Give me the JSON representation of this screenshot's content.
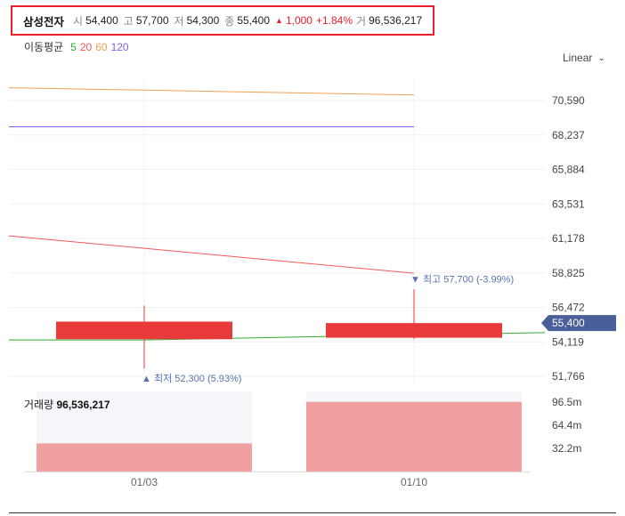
{
  "header": {
    "name": "삼성전자",
    "open_label": "시",
    "open": "54,400",
    "high_label": "고",
    "high": "57,700",
    "low_label": "저",
    "low": "54,300",
    "close_label": "종",
    "close": "55,400",
    "change_arrow": "▲",
    "change": "1,000",
    "change_pct": "+1.84%",
    "volume_label": "거",
    "volume": "96,536,217"
  },
  "ma_legend": {
    "title": "이동평균",
    "items": [
      {
        "label": "5",
        "color": "#2fae2f"
      },
      {
        "label": "20",
        "color": "#f05a5a"
      },
      {
        "label": "60",
        "color": "#f0a050"
      },
      {
        "label": "120",
        "color": "#8a5ae8"
      }
    ]
  },
  "scale_select": {
    "value": "Linear"
  },
  "volume_panel": {
    "title": "거래량",
    "value": "96,536,217"
  },
  "colors": {
    "up": "#e83a3a",
    "vol": "#f0a0a0",
    "vol_bg": "#f5f6fa",
    "price_tag": "#4a5f9a",
    "annot": "#5a72b0"
  },
  "chart_data": {
    "type": "candlestick",
    "x": [
      "01/03",
      "01/10"
    ],
    "candles": [
      {
        "x": "01/03",
        "open": 55500,
        "high": 56600,
        "low": 52300,
        "close": 54300
      },
      {
        "x": "01/10",
        "open": 54400,
        "high": 57700,
        "low": 54300,
        "close": 55400
      }
    ],
    "y_ticks": [
      70590,
      68237,
      65884,
      63531,
      61178,
      58825,
      56472,
      54119,
      51766
    ],
    "y_tick_labels": [
      "70,590",
      "68,237",
      "65,884",
      "63,531",
      "61,178",
      "58,825",
      "56,472",
      "54,119",
      "51,766"
    ],
    "ylim": [
      51000,
      72500
    ],
    "current_price": 55400,
    "current_price_label": "55,400",
    "moving_averages": [
      {
        "name": "5",
        "values": [
          54250,
          54700
        ]
      },
      {
        "name": "20",
        "values": [
          60500,
          58800
        ]
      },
      {
        "name": "60",
        "values": [
          71300,
          70970
        ]
      },
      {
        "name": "120",
        "values": [
          68800,
          68800
        ]
      }
    ],
    "annotations": {
      "high": {
        "x": "01/10",
        "value": 57700,
        "label": "▼ 최고 57,700 (-3.99%)"
      },
      "low": {
        "x": "01/03",
        "value": 52300,
        "label": "▲ 최저 52,300 (5.93%)"
      }
    },
    "volume": {
      "values": [
        39000000,
        96536217
      ],
      "ylim": [
        0,
        111000000
      ],
      "y_ticks": [
        32200000,
        64400000,
        96500000
      ],
      "y_tick_labels": [
        "32.2m",
        "64.4m",
        "96.5m"
      ]
    }
  }
}
